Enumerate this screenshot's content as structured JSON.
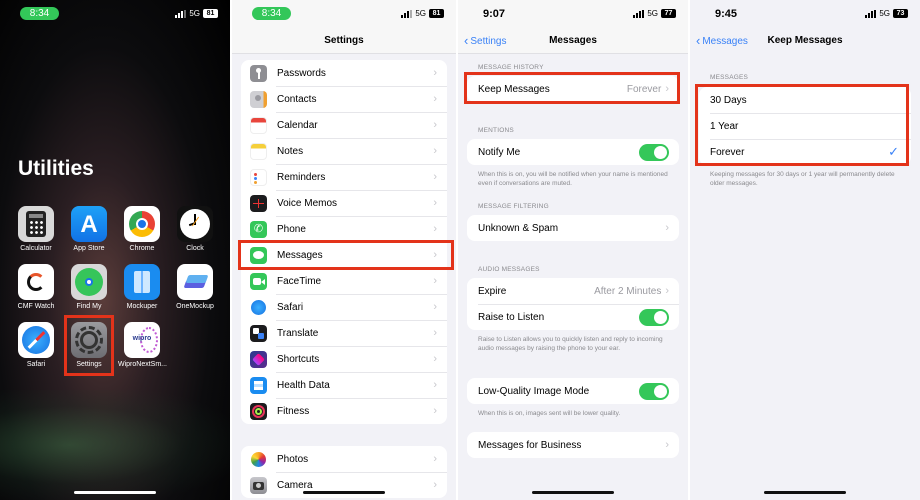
{
  "colors": {
    "highlight": "#e3331a",
    "ios_green": "#34c759",
    "ios_blue": "#3a82f7",
    "group_bg": "#f2f2f7"
  },
  "screen1": {
    "status": {
      "time": "8:34",
      "network": "5G",
      "battery": "81"
    },
    "folder_title": "Utilities",
    "apps": [
      {
        "name": "Calculator",
        "icon": "calculator-icon"
      },
      {
        "name": "App Store",
        "icon": "app-store-icon"
      },
      {
        "name": "Chrome",
        "icon": "chrome-icon"
      },
      {
        "name": "Clock",
        "icon": "clock-icon"
      },
      {
        "name": "CMF Watch",
        "icon": "cmf-watch-icon"
      },
      {
        "name": "Find My",
        "icon": "find-my-icon"
      },
      {
        "name": "Mockuper",
        "icon": "mockuper-icon"
      },
      {
        "name": "OneMockup",
        "icon": "onemockup-icon"
      },
      {
        "name": "Safari",
        "icon": "safari-icon"
      },
      {
        "name": "Settings",
        "icon": "settings-gear-icon",
        "highlighted": true
      },
      {
        "name": "WiproNextSm...",
        "icon": "wipro-icon",
        "badge_text": "wipro"
      }
    ]
  },
  "screen2": {
    "status": {
      "time": "8:34",
      "network": "5G",
      "battery": "81"
    },
    "title": "Settings",
    "group1": [
      {
        "label": "Passwords",
        "icon": "key-icon"
      },
      {
        "label": "Contacts",
        "icon": "contacts-icon"
      },
      {
        "label": "Calendar",
        "icon": "calendar-icon"
      },
      {
        "label": "Notes",
        "icon": "notes-icon"
      },
      {
        "label": "Reminders",
        "icon": "reminders-icon"
      },
      {
        "label": "Voice Memos",
        "icon": "voice-memos-icon"
      },
      {
        "label": "Phone",
        "icon": "phone-icon"
      },
      {
        "label": "Messages",
        "icon": "messages-icon",
        "highlighted": true
      },
      {
        "label": "FaceTime",
        "icon": "facetime-icon"
      },
      {
        "label": "Safari",
        "icon": "safari-icon"
      },
      {
        "label": "Translate",
        "icon": "translate-icon"
      },
      {
        "label": "Shortcuts",
        "icon": "shortcuts-icon"
      },
      {
        "label": "Health Data",
        "icon": "health-data-icon"
      },
      {
        "label": "Fitness",
        "icon": "fitness-icon"
      }
    ],
    "group2": [
      {
        "label": "Photos",
        "icon": "photos-icon"
      },
      {
        "label": "Camera",
        "icon": "camera-icon"
      }
    ]
  },
  "screen3": {
    "status": {
      "time": "9:07",
      "network": "5G",
      "battery": "77"
    },
    "back_label": "Settings",
    "title": "Messages",
    "sections": {
      "history": {
        "header": "MESSAGE HISTORY",
        "keep_messages": {
          "label": "Keep Messages",
          "value": "Forever",
          "highlighted": true
        }
      },
      "mentions": {
        "header": "MENTIONS",
        "notify_me": {
          "label": "Notify Me",
          "on": true
        },
        "footer": "When this is on, you will be notified when your name is mentioned even if conversations are muted."
      },
      "filtering": {
        "header": "MESSAGE FILTERING",
        "unknown_spam": {
          "label": "Unknown & Spam"
        }
      },
      "audio": {
        "header": "AUDIO MESSAGES",
        "expire": {
          "label": "Expire",
          "value": "After 2 Minutes"
        },
        "raise_to_listen": {
          "label": "Raise to Listen",
          "on": true
        },
        "footer": "Raise to Listen allows you to quickly listen and reply to incoming audio messages by raising the phone to your ear."
      },
      "low_quality": {
        "label": "Low-Quality Image Mode",
        "on": true,
        "footer": "When this is on, images sent will be lower quality."
      },
      "business": {
        "label": "Messages for Business"
      }
    }
  },
  "screen4": {
    "status": {
      "time": "9:45",
      "network": "5G",
      "battery": "73"
    },
    "back_label": "Messages",
    "title": "Keep Messages",
    "section_header": "MESSAGES",
    "options": [
      {
        "label": "30 Days",
        "selected": false
      },
      {
        "label": "1 Year",
        "selected": false
      },
      {
        "label": "Forever",
        "selected": true
      }
    ],
    "footer": "Keeping messages for 30 days or 1 year will permanently delete older messages."
  }
}
